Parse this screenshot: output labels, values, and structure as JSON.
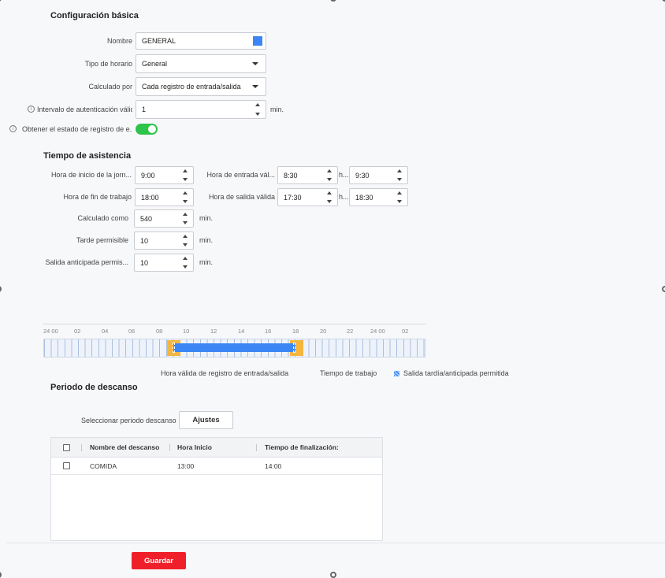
{
  "basic": {
    "title": "Configuración básica",
    "name_label": "Nombre",
    "name_value": "GENERAL",
    "name_color": "#3b86f4",
    "schedule_type_label": "Tipo de horario",
    "schedule_type_value": "General",
    "calculated_by_label": "Calculado por",
    "calculated_by_value": "Cada registro de entrada/salida",
    "auth_interval_label": "Intervalo de autenticación válido",
    "auth_interval_value": "1",
    "auth_interval_unit": "min.",
    "get_status_label": "Obtener el estado de registro de e..."
  },
  "attendance": {
    "title": "Tiempo de asistencia",
    "start_label": "Hora de inicio de la jorn...",
    "start_value": "9:00",
    "valid_in_label": "Hora de entrada vál...",
    "valid_in_from": "8:30",
    "valid_in_sep": "h...",
    "valid_in_to": "9:30",
    "end_label": "Hora de fin de trabajo",
    "end_value": "18:00",
    "valid_out_label": "Hora de salida válida",
    "valid_out_from": "17:30",
    "valid_out_sep": "h...",
    "valid_out_to": "18:30",
    "calc_as_label": "Calculado como",
    "calc_as_value": "540",
    "calc_as_unit": "min.",
    "late_label": "Tarde permisible",
    "late_value": "10",
    "late_unit": "min.",
    "early_label": "Salida anticipada permis...",
    "early_value": "10",
    "early_unit": "min."
  },
  "timeline": {
    "ticks": [
      "24 00",
      "02",
      "04",
      "06",
      "08",
      "10",
      "12",
      "14",
      "16",
      "18",
      "20",
      "22",
      "24 00",
      "02"
    ],
    "work_color": "#3b86f4",
    "valid_color": "#f6b63e",
    "legend_valid": "Hora válida de registro de entrada/salida",
    "legend_work": "Tiempo de trabajo",
    "legend_late": "Salida tardía/anticipada permitida"
  },
  "rest": {
    "title": "Periodo de descanso",
    "select_label": "Seleccionar periodo descanso",
    "settings_button": "Ajustes",
    "headers": {
      "name": "Nombre del descanso",
      "start": "Hora Inicio",
      "end": "Tiempo de finalización:"
    },
    "rows": [
      {
        "name": "COMIDA",
        "start": "13:00",
        "end": "14:00"
      }
    ]
  },
  "footer": {
    "save_button": "Guardar",
    "save_color": "#f0202b"
  }
}
